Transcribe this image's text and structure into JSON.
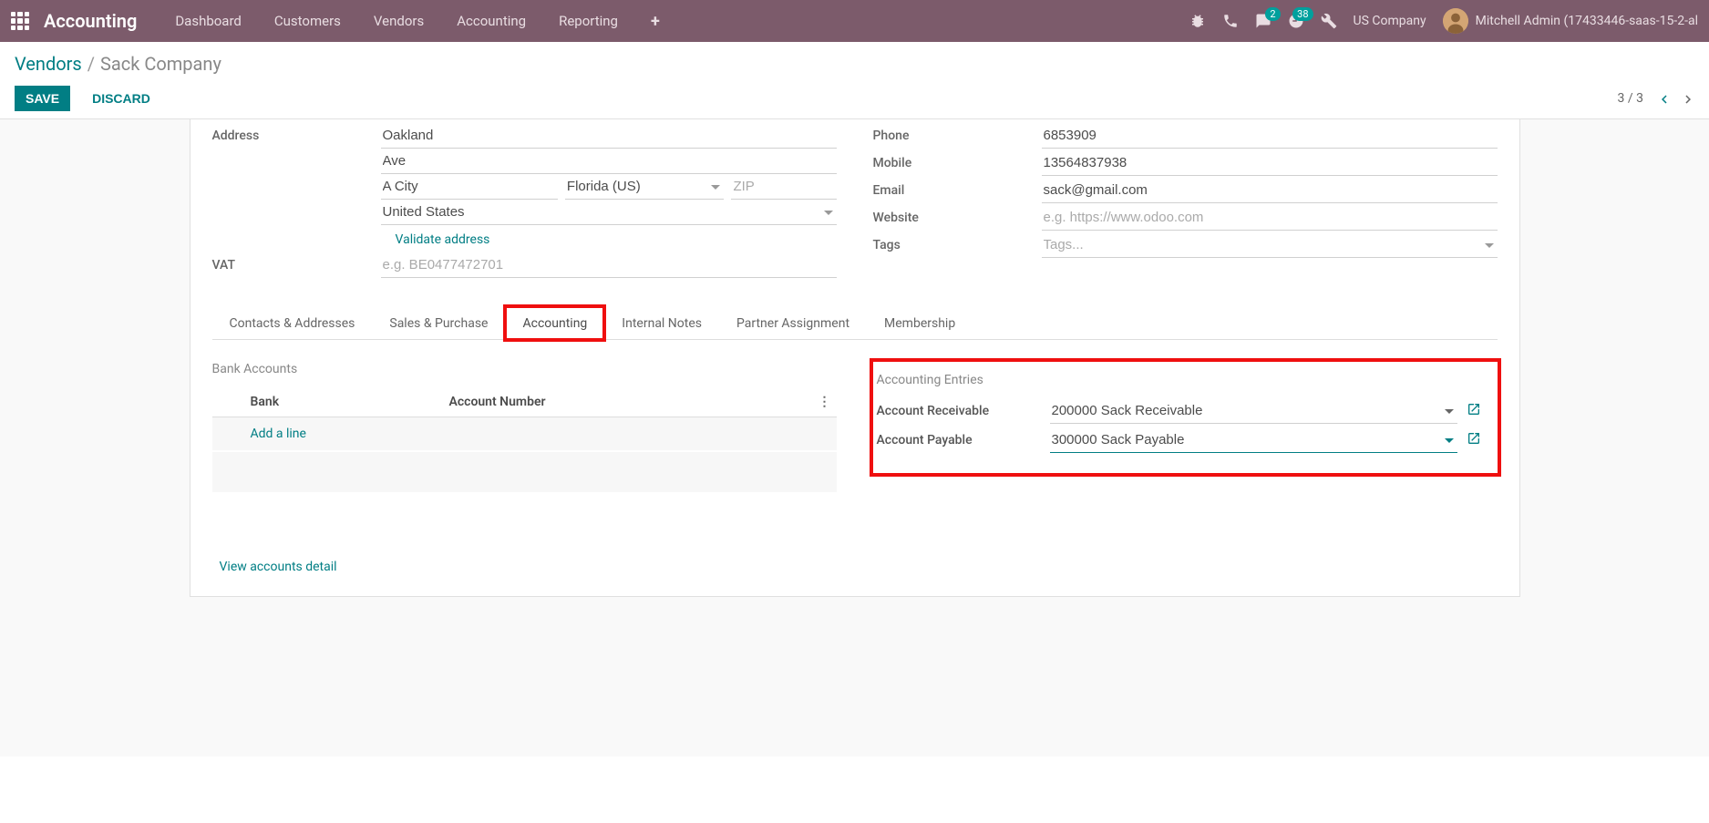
{
  "nav": {
    "brand": "Accounting",
    "menu": [
      "Dashboard",
      "Customers",
      "Vendors",
      "Accounting",
      "Reporting"
    ],
    "conversations_badge": "2",
    "activities_badge": "38",
    "company": "US Company",
    "user": "Mitchell Admin (17433446-saas-15-2-al"
  },
  "breadcrumb": {
    "parent": "Vendors",
    "current": "Sack Company"
  },
  "buttons": {
    "save": "SAVE",
    "discard": "DISCARD"
  },
  "pager": "3 / 3",
  "form": {
    "left": {
      "address_label": "Address",
      "street": "Oakland",
      "street2": "Ave",
      "city": "A City",
      "state": "Florida (US)",
      "zip_placeholder": "ZIP",
      "country": "United States",
      "validate": "Validate address",
      "vat_label": "VAT",
      "vat_placeholder": "e.g. BE0477472701"
    },
    "right": {
      "phone_label": "Phone",
      "phone": "6853909",
      "mobile_label": "Mobile",
      "mobile": "13564837938",
      "email_label": "Email",
      "email": "sack@gmail.com",
      "website_label": "Website",
      "website_placeholder": "e.g. https://www.odoo.com",
      "tags_label": "Tags",
      "tags_placeholder": "Tags..."
    }
  },
  "tabs": [
    "Contacts & Addresses",
    "Sales & Purchase",
    "Accounting",
    "Internal Notes",
    "Partner Assignment",
    "Membership"
  ],
  "tab_content": {
    "bank": {
      "section": "Bank Accounts",
      "col1": "Bank",
      "col2": "Account Number",
      "add": "Add a line"
    },
    "entries": {
      "section": "Accounting Entries",
      "receivable_label": "Account Receivable",
      "receivable": "200000 Sack Receivable",
      "payable_label": "Account Payable",
      "payable": "300000 Sack Payable"
    },
    "view_detail": "View accounts detail"
  }
}
